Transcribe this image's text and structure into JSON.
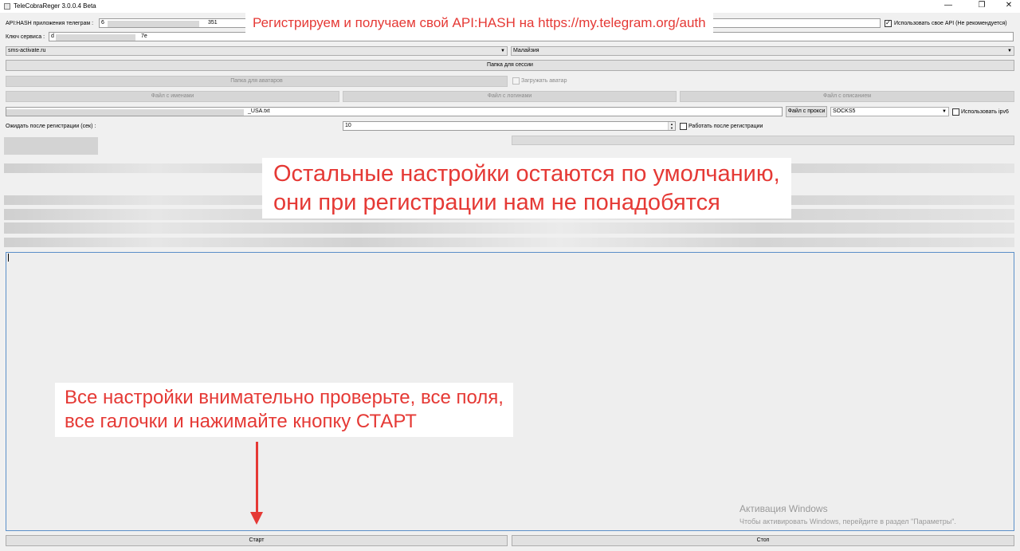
{
  "window": {
    "title": "TeleCobraReger 3.0.0.4 Beta",
    "minimize_glyph": "—",
    "restore_glyph": "❐",
    "close_glyph": "✕"
  },
  "api_hash": {
    "label": "API:HASH приложения телеграм :",
    "value_start": "6",
    "value_end": "351",
    "use_own_label": "Использовать свое API (Не рекомендуется)",
    "use_own_checked": true
  },
  "service_key": {
    "label": "Ключ сервиса :",
    "value_start": "d",
    "value_end": "7e"
  },
  "service_combo": {
    "value": "sms-activate.ru"
  },
  "country_combo": {
    "value": "Малайзия"
  },
  "session_folder_button": "Папка для сессии",
  "avatar_folder_button": "Папка для аватаров",
  "upload_avatar_label": "Загружать аватар",
  "names_file_button": "Файл с именами",
  "logins_file_button": "Файл с логинами",
  "descriptions_file_button": "Файл с описанием",
  "proxy_file_path_tail": "_USA.txt",
  "proxy_file_button": "Файл с прокси",
  "proxy_type_combo": {
    "value": "SOCKS5"
  },
  "ipv6_label": "Использовать ipv6",
  "wait_label": "Ожидать после регистрации (сек) :",
  "wait_value": "10",
  "work_after_label": "Работать после регистрации",
  "start_button": "Старт",
  "stop_button": "Стоп",
  "callouts": {
    "api_hint": "Регистрируем и получаем свой API:HASH на https://my.telegram.org/auth",
    "defaults_line1": "Остальные настройки остаются по умолчанию,",
    "defaults_line2": "они при регистрации нам не понадобятся",
    "check_line1": "Все настройки внимательно проверьте, все поля,",
    "check_line2": "все галочки и нажимайте кнопку СТАРТ"
  },
  "watermark": {
    "title": "Активация Windows",
    "subtitle": "Чтобы активировать Windows, перейдите в раздел \"Параметры\"."
  },
  "colors": {
    "accent_red": "#e53935",
    "log_border": "#5b8fc9"
  },
  "icons": [
    "app-icon",
    "minimize-icon",
    "restore-icon",
    "close-icon",
    "dropdown-arrow-icon",
    "arrow-down-icon"
  ]
}
